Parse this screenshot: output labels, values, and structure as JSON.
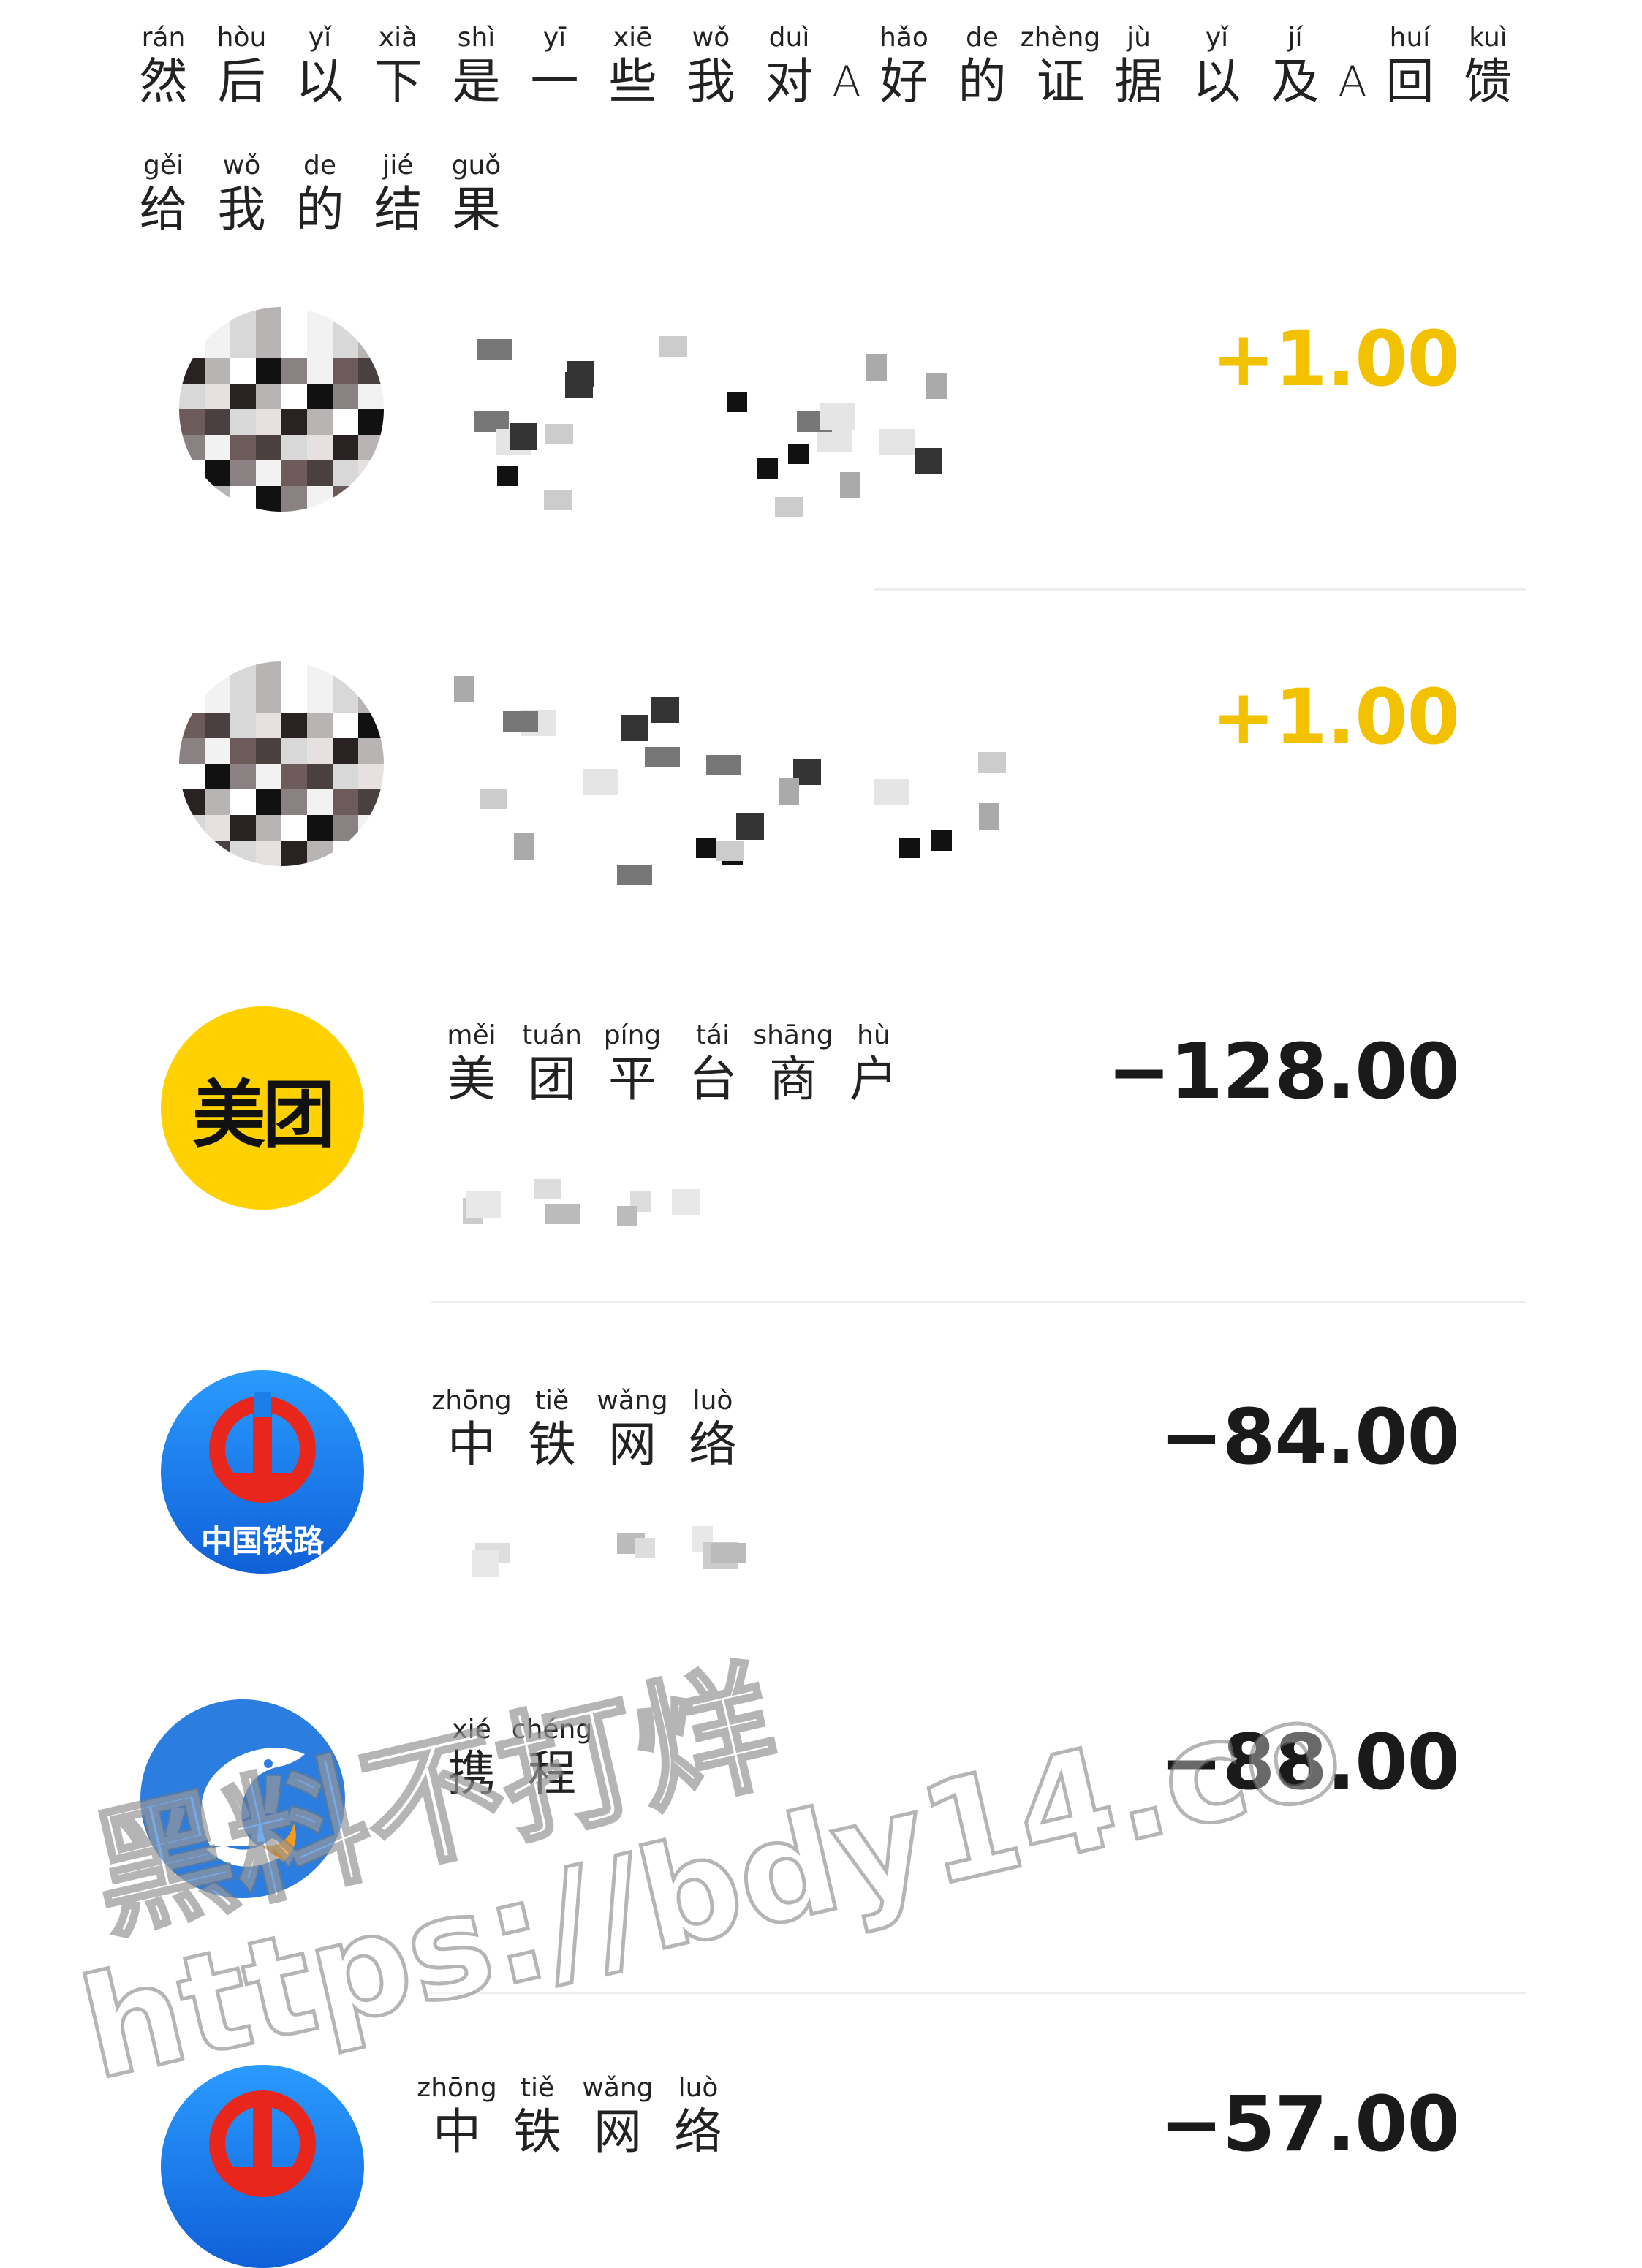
{
  "caption": {
    "line1": [
      {
        "py": "rán",
        "hz": "然"
      },
      {
        "py": "hòu",
        "hz": "后"
      },
      {
        "py": "yǐ",
        "hz": "以"
      },
      {
        "py": "xià",
        "hz": "下"
      },
      {
        "py": "shì",
        "hz": "是"
      },
      {
        "py": "yī",
        "hz": "一"
      },
      {
        "py": "xiē",
        "hz": "些"
      },
      {
        "py": "wǒ",
        "hz": "我"
      },
      {
        "py": "duì",
        "hz": "对"
      },
      {
        "py": "",
        "hz": "A"
      },
      {
        "py": "hǎo",
        "hz": "好"
      },
      {
        "py": "de",
        "hz": "的"
      },
      {
        "py": "zhèng",
        "hz": "证"
      },
      {
        "py": "jù",
        "hz": "据"
      },
      {
        "py": "yǐ",
        "hz": "以"
      },
      {
        "py": "jí",
        "hz": "及"
      },
      {
        "py": "",
        "hz": "A"
      },
      {
        "py": "huí",
        "hz": "回"
      },
      {
        "py": "kuì",
        "hz": "馈"
      }
    ],
    "line2": [
      {
        "py": "gěi",
        "hz": "给"
      },
      {
        "py": "wǒ",
        "hz": "我"
      },
      {
        "py": "de",
        "hz": "的"
      },
      {
        "py": "jié",
        "hz": "结"
      },
      {
        "py": "guǒ",
        "hz": "果"
      }
    ]
  },
  "transactions": [
    {
      "amount": "+1.00",
      "kind": "income"
    },
    {
      "amount": "+1.00",
      "kind": "income"
    },
    {
      "amount": "−128.00",
      "kind": "expense",
      "logo_text": "美团",
      "name": [
        {
          "py": "měi",
          "hz": "美"
        },
        {
          "py": "tuán",
          "hz": "团"
        },
        {
          "py": "píng",
          "hz": "平"
        },
        {
          "py": "tái",
          "hz": "台"
        },
        {
          "py": "shāng",
          "hz": "商"
        },
        {
          "py": "hù",
          "hz": "户"
        }
      ]
    },
    {
      "amount": "−84.00",
      "kind": "expense",
      "logo_text": "中国铁路",
      "name": [
        {
          "py": "zhōng",
          "hz": "中"
        },
        {
          "py": "tiě",
          "hz": "铁"
        },
        {
          "py": "wǎng",
          "hz": "网"
        },
        {
          "py": "luò",
          "hz": "络"
        }
      ]
    },
    {
      "amount": "−88.00",
      "kind": "expense",
      "name": [
        {
          "py": "xié",
          "hz": "携"
        },
        {
          "py": "chéng",
          "hz": "程"
        }
      ]
    },
    {
      "amount": "−57.00",
      "kind": "expense",
      "name": [
        {
          "py": "zhōng",
          "hz": "中"
        },
        {
          "py": "tiě",
          "hz": "铁"
        },
        {
          "py": "wǎng",
          "hz": "网"
        },
        {
          "py": "luò",
          "hz": "络"
        }
      ]
    }
  ],
  "watermark": {
    "line1": "黑料不打烊",
    "line2": "https://bdy14.co"
  },
  "colors": {
    "income": "#f2c200",
    "expense": "#1a1a1a",
    "meituan": "#ffd100",
    "railway": "#1a7fe8",
    "ctrip": "#2b7de0"
  }
}
